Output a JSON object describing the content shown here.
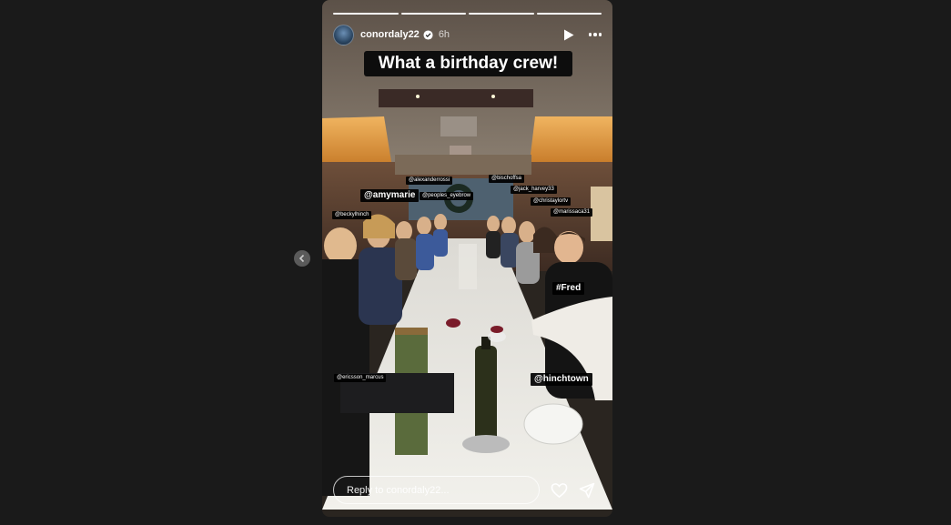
{
  "story": {
    "username": "conordaly22",
    "time": "6h",
    "caption": "What a birthday crew!",
    "progress_segments": 4,
    "current_segment": 4,
    "reply_placeholder": "Reply to conordaly22..."
  },
  "tags": {
    "alexanderrossi": "@alexanderrossi",
    "bischoffsa": "@bischoffsa",
    "jack_harvey33": "@jack_harvey33",
    "amymarie": "@amymarie",
    "peoples_eyebrow": "@peoples_eyebrow",
    "christaylortv": "@christaylortv",
    "beckylhinch": "@beckylhinch",
    "marissaca31": "@marissaca31",
    "fred": "#Fred",
    "ericsson_marcus": "@ericsson_marcus",
    "hinchtown": "@hinchtown"
  },
  "icons": {
    "prev": "chevron-left-icon",
    "verified": "verified-badge-icon",
    "play": "play-icon",
    "more": "more-options-icon",
    "like": "heart-icon",
    "send": "send-icon"
  }
}
